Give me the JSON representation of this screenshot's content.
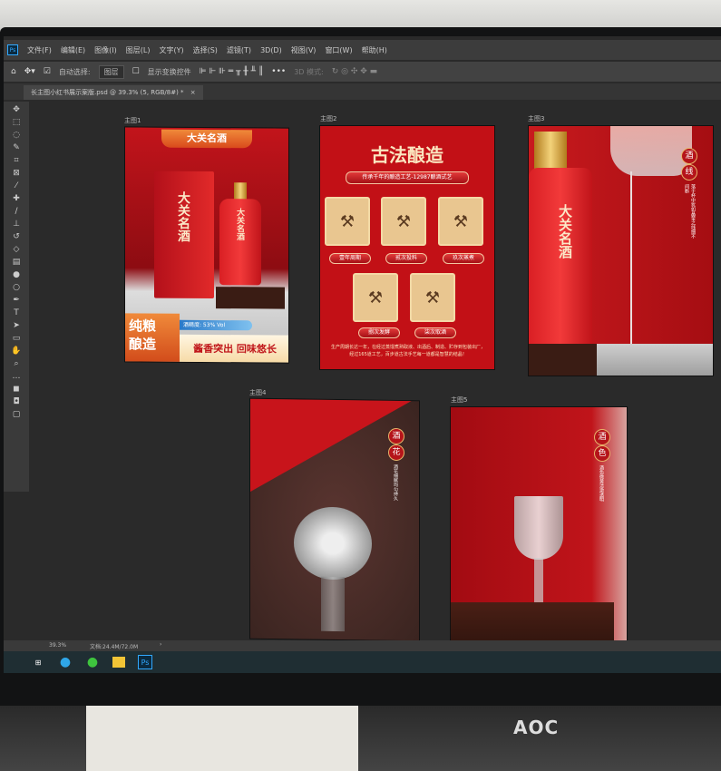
{
  "menu": [
    "文件(F)",
    "编辑(E)",
    "图像(I)",
    "图层(L)",
    "文字(Y)",
    "选择(S)",
    "滤镜(T)",
    "3D(D)",
    "视图(V)",
    "窗口(W)",
    "帮助(H)"
  ],
  "app_icon": "Ps",
  "options": {
    "auto_select": "自动选择:",
    "layer_select": "图层",
    "show_transform": "显示变换控件",
    "more": "•••",
    "mode_3d": "3D 模式:"
  },
  "document_tab": {
    "title": "长主图小红书展示案版.psd @ 39.3% (5, RGB/8#) *",
    "close": "×"
  },
  "artboards": [
    {
      "label": "主图1",
      "ribbon": "大关名酒",
      "brand": "大关名酒",
      "abv": "酒精度: 53% Vol",
      "left_text": "纯粮\n酿造",
      "slogan": "酱香突出 回味悠长"
    },
    {
      "label": "主图2",
      "title": "古法酿造",
      "subtitle": "传承千年的酿造工艺-12987酿酒式艺",
      "steps": [
        "壹年周期",
        "贰次投料",
        "玖次蒸煮",
        "捌次发酵",
        "柒次取酒"
      ],
      "footer": "生产周期长达一年，在经过蒸馏煮熟取液、出酒后、制造、贮存到包装出厂，经过165道工艺，百步道古法手艺每一道都是智慧的结晶！"
    },
    {
      "label": "主图3",
      "brand": "大关名酒",
      "badge": [
        "酒",
        "线"
      ],
      "caption": "落于杯中犹如晶莹之线细不间断"
    },
    {
      "label": "主图4",
      "badge": [
        "酒",
        "花"
      ],
      "caption": "酒花细腻均匀持久"
    },
    {
      "label": "主图5",
      "badge": [
        "酒",
        "色"
      ],
      "caption": "酒色微黄清澈透明"
    }
  ],
  "status": {
    "zoom": "39.3%",
    "doc": "文档:24.4M/72.0M"
  },
  "monitor_brand": "AOC",
  "colors": {
    "accent": "#c21016",
    "canvas": "#2a2a2a"
  }
}
